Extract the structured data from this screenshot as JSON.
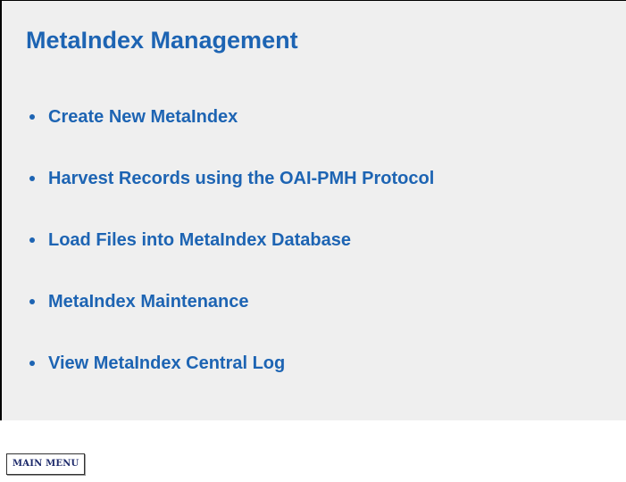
{
  "header": {
    "title": "MetaIndex Management"
  },
  "menu": {
    "items": [
      {
        "label": "Create New MetaIndex"
      },
      {
        "label": "Harvest Records using the OAI-PMH Protocol"
      },
      {
        "label": "Load Files into MetaIndex Database"
      },
      {
        "label": "MetaIndex Maintenance"
      },
      {
        "label": "View MetaIndex Central Log"
      }
    ]
  },
  "footer": {
    "main_menu_label": "MAIN MENU"
  },
  "colors": {
    "link": "#1d64b3",
    "panel_background": "#efefef"
  }
}
